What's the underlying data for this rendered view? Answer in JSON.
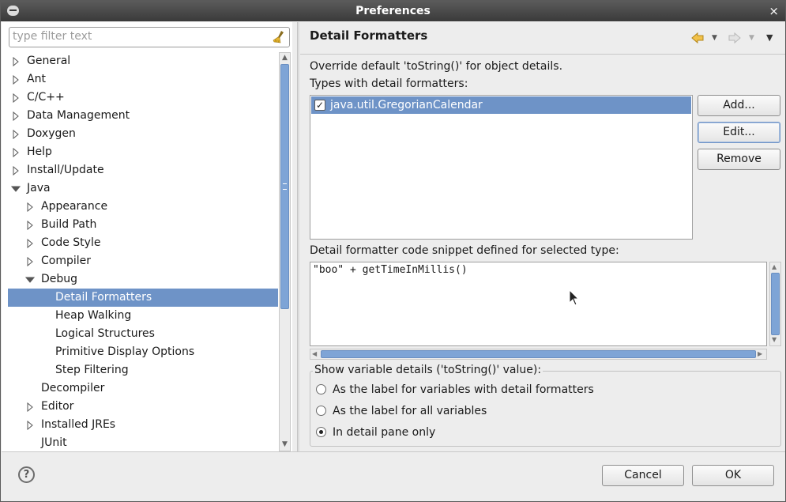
{
  "window": {
    "title": "Preferences",
    "close_label": "×"
  },
  "filter": {
    "placeholder": "type filter text"
  },
  "tree": [
    {
      "label": "General",
      "level": 0,
      "state": "collapsed"
    },
    {
      "label": "Ant",
      "level": 0,
      "state": "collapsed"
    },
    {
      "label": "C/C++",
      "level": 0,
      "state": "collapsed"
    },
    {
      "label": "Data Management",
      "level": 0,
      "state": "collapsed"
    },
    {
      "label": "Doxygen",
      "level": 0,
      "state": "collapsed"
    },
    {
      "label": "Help",
      "level": 0,
      "state": "collapsed"
    },
    {
      "label": "Install/Update",
      "level": 0,
      "state": "collapsed"
    },
    {
      "label": "Java",
      "level": 0,
      "state": "expanded"
    },
    {
      "label": "Appearance",
      "level": 1,
      "state": "collapsed"
    },
    {
      "label": "Build Path",
      "level": 1,
      "state": "collapsed"
    },
    {
      "label": "Code Style",
      "level": 1,
      "state": "collapsed"
    },
    {
      "label": "Compiler",
      "level": 1,
      "state": "collapsed"
    },
    {
      "label": "Debug",
      "level": 1,
      "state": "expanded"
    },
    {
      "label": "Detail Formatters",
      "level": 2,
      "state": "leaf",
      "selected": true
    },
    {
      "label": "Heap Walking",
      "level": 2,
      "state": "leaf"
    },
    {
      "label": "Logical Structures",
      "level": 2,
      "state": "leaf"
    },
    {
      "label": "Primitive Display Options",
      "level": 2,
      "state": "leaf"
    },
    {
      "label": "Step Filtering",
      "level": 2,
      "state": "leaf"
    },
    {
      "label": "Decompiler",
      "level": 1,
      "state": "leaf"
    },
    {
      "label": "Editor",
      "level": 1,
      "state": "collapsed"
    },
    {
      "label": "Installed JREs",
      "level": 1,
      "state": "collapsed"
    },
    {
      "label": "JUnit",
      "level": 1,
      "state": "leaf"
    }
  ],
  "page": {
    "title": "Detail Formatters",
    "description": "Override default 'toString()' for object details.",
    "types_label": "Types with detail formatters:",
    "types": [
      {
        "label": "java.util.GregorianCalendar",
        "checked": true
      }
    ],
    "buttons": {
      "add": "Add...",
      "edit": "Edit...",
      "remove": "Remove"
    },
    "snippet_label": "Detail formatter code snippet defined for selected type:",
    "snippet_code": "\"boo\" + getTimeInMillis()",
    "show_group_label": "Show variable details ('toString()' value):",
    "options": [
      {
        "label": "As the label for variables with detail formatters",
        "selected": false
      },
      {
        "label": "As the label for all variables",
        "selected": false
      },
      {
        "label": "In detail pane only",
        "selected": true
      }
    ]
  },
  "footer": {
    "help_label": "?",
    "cancel": "Cancel",
    "ok": "OK"
  },
  "colors": {
    "selection": "#6e93c7",
    "back_arrow": "#d9a42b",
    "title_bar": "#3a3a3a"
  },
  "icons": {
    "back": "arrow-left-icon",
    "forward": "arrow-right-icon",
    "menu": "view-menu-icon",
    "clear": "broom-icon"
  }
}
